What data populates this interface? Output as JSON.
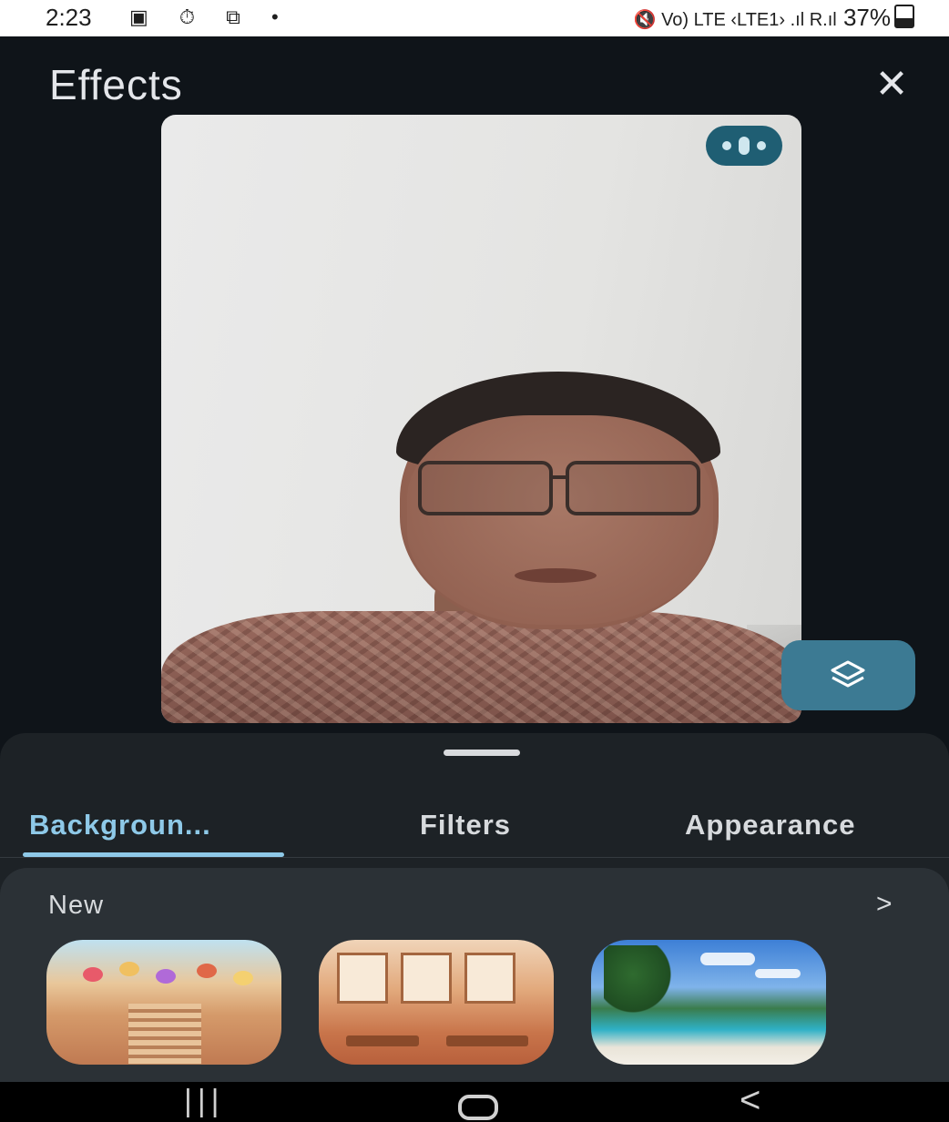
{
  "status_bar": {
    "time": "2:23",
    "left_icons": [
      "gallery-icon",
      "timer-icon",
      "screenshot-icon",
      "dot-icon"
    ],
    "left_glyphs": "▣ ⏱ ⧉ •",
    "right_text": "🔇 Vo) LTE ‹LTE1› .ıl R.ıl",
    "battery": "37%"
  },
  "header": {
    "title": "Effects",
    "close_glyph": "✕"
  },
  "preview": {
    "more_button_icon": "more-options-icon",
    "layers_button_icon": "layers-icon"
  },
  "tabs": [
    {
      "label": "Backgroun...",
      "active": true
    },
    {
      "label": "Filters",
      "active": false
    },
    {
      "label": "Appearance",
      "active": false
    }
  ],
  "section": {
    "title": "New",
    "arrow": ">"
  },
  "thumbnails": [
    {
      "name": "street-market-background",
      "colors": [
        "#bfe1f0",
        "#d59a6a"
      ]
    },
    {
      "name": "cafe-interior-background",
      "colors": [
        "#f0d4b8",
        "#c8744a"
      ]
    },
    {
      "name": "tropical-beach-background",
      "colors": [
        "#3d7fd6",
        "#2fb1c6"
      ]
    }
  ],
  "navbar": {
    "recent_glyph": "|||",
    "back_glyph": "<"
  },
  "colors": {
    "accent": "#8ec9e8",
    "background": "#0f1419",
    "sheet": "#1d2226",
    "panel": "#2b3136",
    "more_button": "#1f5e73",
    "layers_button": "#3c7a93"
  }
}
